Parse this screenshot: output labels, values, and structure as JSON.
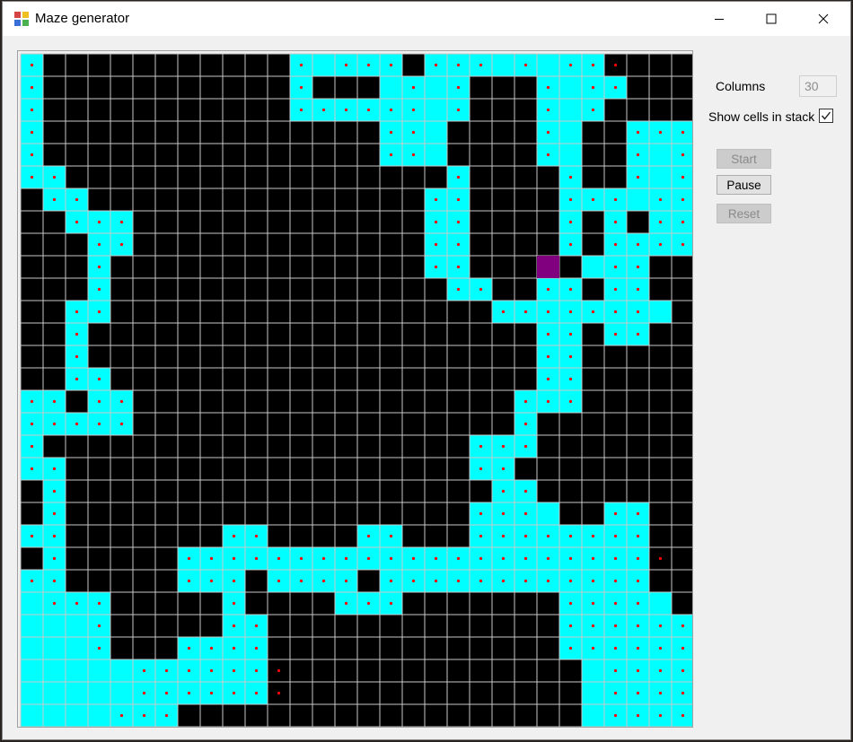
{
  "window": {
    "title": "Maze generator",
    "controls": [
      "minimize",
      "maximize",
      "close"
    ]
  },
  "settings": {
    "columns_label": "Columns",
    "columns_value": "30",
    "show_stack_label": "Show cells in stack",
    "show_stack_checked": true
  },
  "buttons": {
    "start": "Start",
    "pause": "Pause",
    "reset": "Reset"
  },
  "colors": {
    "unvisited": "#000000",
    "visited": "#00ffff",
    "current": "#800080",
    "stack_marker": "#ff0000",
    "grid_line": "#c8c8c8",
    "wall": "#ffffff"
  },
  "maze": {
    "columns": 30,
    "rows": 30,
    "current_cell": [
      23,
      9
    ],
    "visited_rows": [
      "X...........XXXXX.XXXXXXXX....",
      "X...........X...XXXX...XXXX....",
      "X...........XXXXXXXX...XXX.....",
      "X...............XXX....XX..XXX",
      "X...............XXX....XX..XXX",
      "XX.................X....X..XXX",
      ".XX...............XX....XXXXXX",
      "..XXX.............XX....X.X.XX",
      "...XX.............XX....X.XXXX",
      "...X..............XX.....XXX..",
      "...X...............XX..XX.XX..",
      "..XX.................XXXXXXXX.",
      "..X....................XX.XX..",
      "..X....................XX.....",
      "..XX...................XX.....",
      "XX.XX.................XXX.....",
      "XXXXX.................X.......",
      "X...................XXX.......",
      "XX..................XX........",
      ".X...................XX.......",
      ".X..................XXXX..XX..",
      "XX.......XX....XX...XXXXXXXX..",
      ".X.....XXXXXXXXXXXXXXXXXXXXX..",
      "XX.....XXX.XXXX.XXXXXXXXXXXX..",
      "XXXX.....X....XXX.......XXXXX.",
      "XXXX.....XX.............XXXXXX",
      "XXXX...XXXX.............XXXXXX",
      "XXXXXXXXXXX..............XXXXX",
      "XXXXXXXXXXX..............XXXXX",
      "XXXXXXX..................XXXXX."
    ],
    "stack_rows": [
      "o...........o.ooo.ooo.o.ooo...",
      "o...........o....o.o...o.oo...",
      "o...........oooooo.o...o.o....",
      "o...............oo.....o...ooo",
      "o...............oo.....o...o.o",
      "oo.................o....o..o.o",
      ".oo...............oo....ooo.oo",
      "..ooo.............oo....o.o.oo",
      "...oo.............oo....o.oooo",
      "...o..............oo......oo..",
      "...o...............oo..oo.oo..",
      "..oo.................ooooooo..",
      "..o....................oo.oo..",
      "..o....................oo.....",
      "..oo...................oo.....",
      "oo.oo.................ooo.....",
      "ooooo.................o.......",
      "o...................ooo.......",
      "oo..................oo........",
      ".o...................oo.......",
      ".o..................ooo...oo..",
      "oo.......oo....oo...oooooooo..",
      ".o.....oooooooooooooooooooooo.",
      "oo.....ooo.oooo.oooooooooooo..",
      ".ooo.....o....ooo.......oooo..",
      "...o.....oo.............oooooo",
      "...o...oooo.............oooooo",
      ".....ooooooo..............oooo",
      ".....ooooooo..............oooo",
      "....ooo...................oooo."
    ]
  }
}
